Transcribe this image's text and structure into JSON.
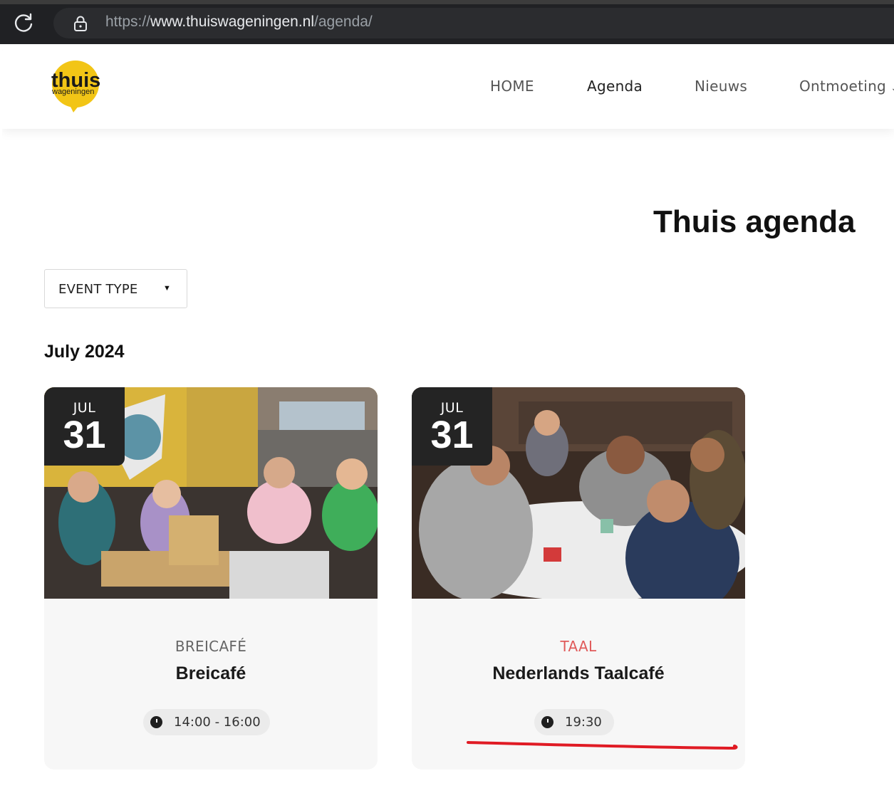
{
  "browser": {
    "url_prefix": "https://",
    "url_host": "www.thuiswageningen.nl",
    "url_path": "/agenda/"
  },
  "header": {
    "logo_text_main": "thuis",
    "logo_text_sub": "wageningen",
    "logo_color": "#f2c516",
    "nav": [
      {
        "label": "HOME"
      },
      {
        "label": "Agenda"
      },
      {
        "label": "Nieuws"
      },
      {
        "label": "Ontmoeting"
      }
    ]
  },
  "main": {
    "title": "Thuis agenda",
    "filter": {
      "label": "EVENT TYPE"
    },
    "month": "July 2024",
    "events": [
      {
        "month": "JUL",
        "day": "31",
        "category": "BREICAFÉ",
        "title": "Breicafé",
        "time": "14:00 - 16:00",
        "image": "people-knitting-in-cafe"
      },
      {
        "month": "JUL",
        "day": "31",
        "category": "TAAL",
        "category_color": "#e05a5a",
        "title": "Nederlands Taalcafé",
        "time": "19:30",
        "image": "people-at-table-in-cafe"
      }
    ]
  },
  "annotation": {
    "underline_color": "#e01b24"
  }
}
